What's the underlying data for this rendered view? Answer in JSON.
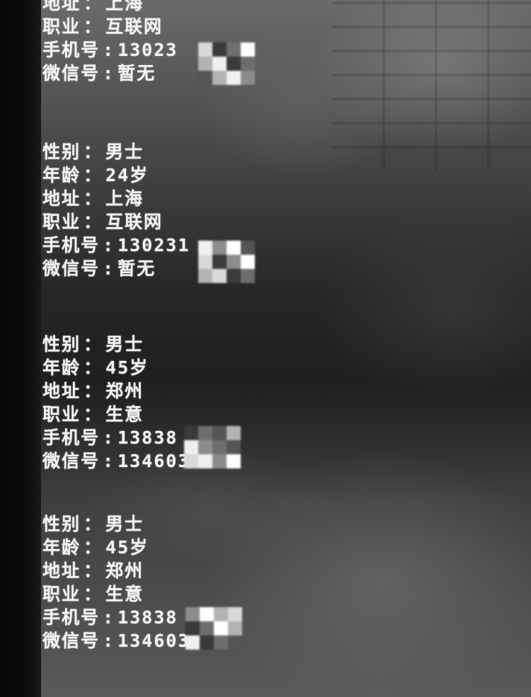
{
  "records": [
    {
      "rows": [
        {
          "label": "地址",
          "sep": "：",
          "value": "上海"
        },
        {
          "label": "职业",
          "sep": "：",
          "value": "互联网"
        },
        {
          "label": "手机号",
          "sep": ":",
          "value": "13023"
        },
        {
          "label": "微信号",
          "sep": ":",
          "value": "暂无"
        }
      ]
    },
    {
      "rows": [
        {
          "label": "性别",
          "sep": "：",
          "value": "男士"
        },
        {
          "label": "年龄",
          "sep": "：",
          "value": "24岁"
        },
        {
          "label": "地址",
          "sep": "：",
          "value": "上海"
        },
        {
          "label": "职业",
          "sep": "：",
          "value": "互联网"
        },
        {
          "label": "手机号",
          "sep": ":",
          "value": "130231"
        },
        {
          "label": "微信号",
          "sep": ":",
          "value": "暂无"
        }
      ]
    },
    {
      "rows": [
        {
          "label": "性别",
          "sep": "：",
          "value": "男士"
        },
        {
          "label": "年龄",
          "sep": "：",
          "value": "45岁"
        },
        {
          "label": "地址",
          "sep": "：",
          "value": "郑州"
        },
        {
          "label": "职业",
          "sep": "：",
          "value": "生意"
        },
        {
          "label": "手机号",
          "sep": ":",
          "value": "13838"
        },
        {
          "label": "微信号",
          "sep": ":",
          "value": "134603"
        }
      ]
    },
    {
      "rows": [
        {
          "label": "性别",
          "sep": "：",
          "value": "男士"
        },
        {
          "label": "年龄",
          "sep": "：",
          "value": "45岁"
        },
        {
          "label": "地址",
          "sep": "：",
          "value": "郑州"
        },
        {
          "label": "职业",
          "sep": "：",
          "value": "生意"
        },
        {
          "label": "手机号",
          "sep": ":",
          "value": "13838"
        },
        {
          "label": "微信号",
          "sep": ":",
          "value": "134603"
        }
      ]
    }
  ],
  "redaction": {
    "palette": [
      "#d9d9d9",
      "#8c8c8c",
      "#555555",
      "#f0f0f0",
      "#6e6e6e",
      "#b3b3b3",
      "#3a3a3a",
      "#ffffff"
    ]
  }
}
